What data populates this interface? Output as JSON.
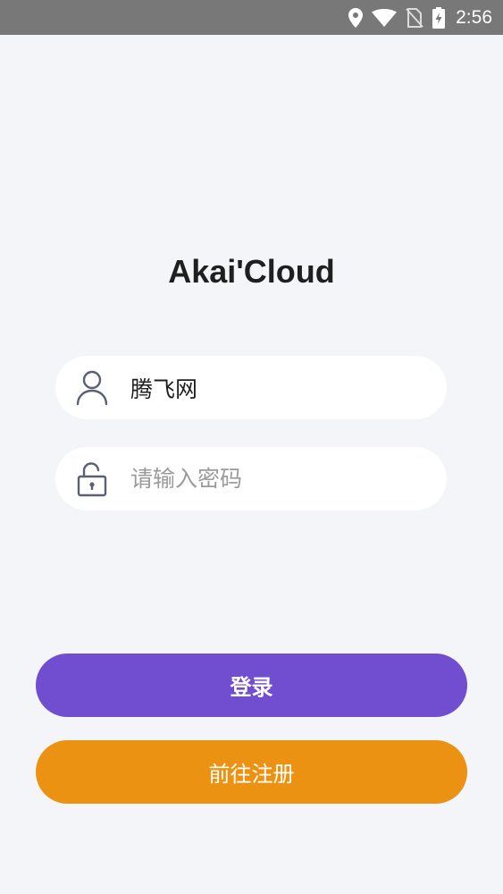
{
  "status_bar": {
    "time": "2:56",
    "icons": [
      "location-icon",
      "wifi-icon",
      "no-sim-icon",
      "battery-charging-icon"
    ]
  },
  "app": {
    "title": "Akai'Cloud"
  },
  "login_form": {
    "username": {
      "value": "腾飞网",
      "icon": "user-icon"
    },
    "password": {
      "value": "",
      "placeholder": "请输入密码",
      "icon": "unlock-icon"
    },
    "login_label": "登录",
    "register_label": "前往注册"
  },
  "colors": {
    "status_bar_bg": "#787878",
    "page_bg": "#f4f5f8",
    "login_button": "#714dcf",
    "register_button": "#ec9212",
    "field_icon": "#5b6072"
  }
}
